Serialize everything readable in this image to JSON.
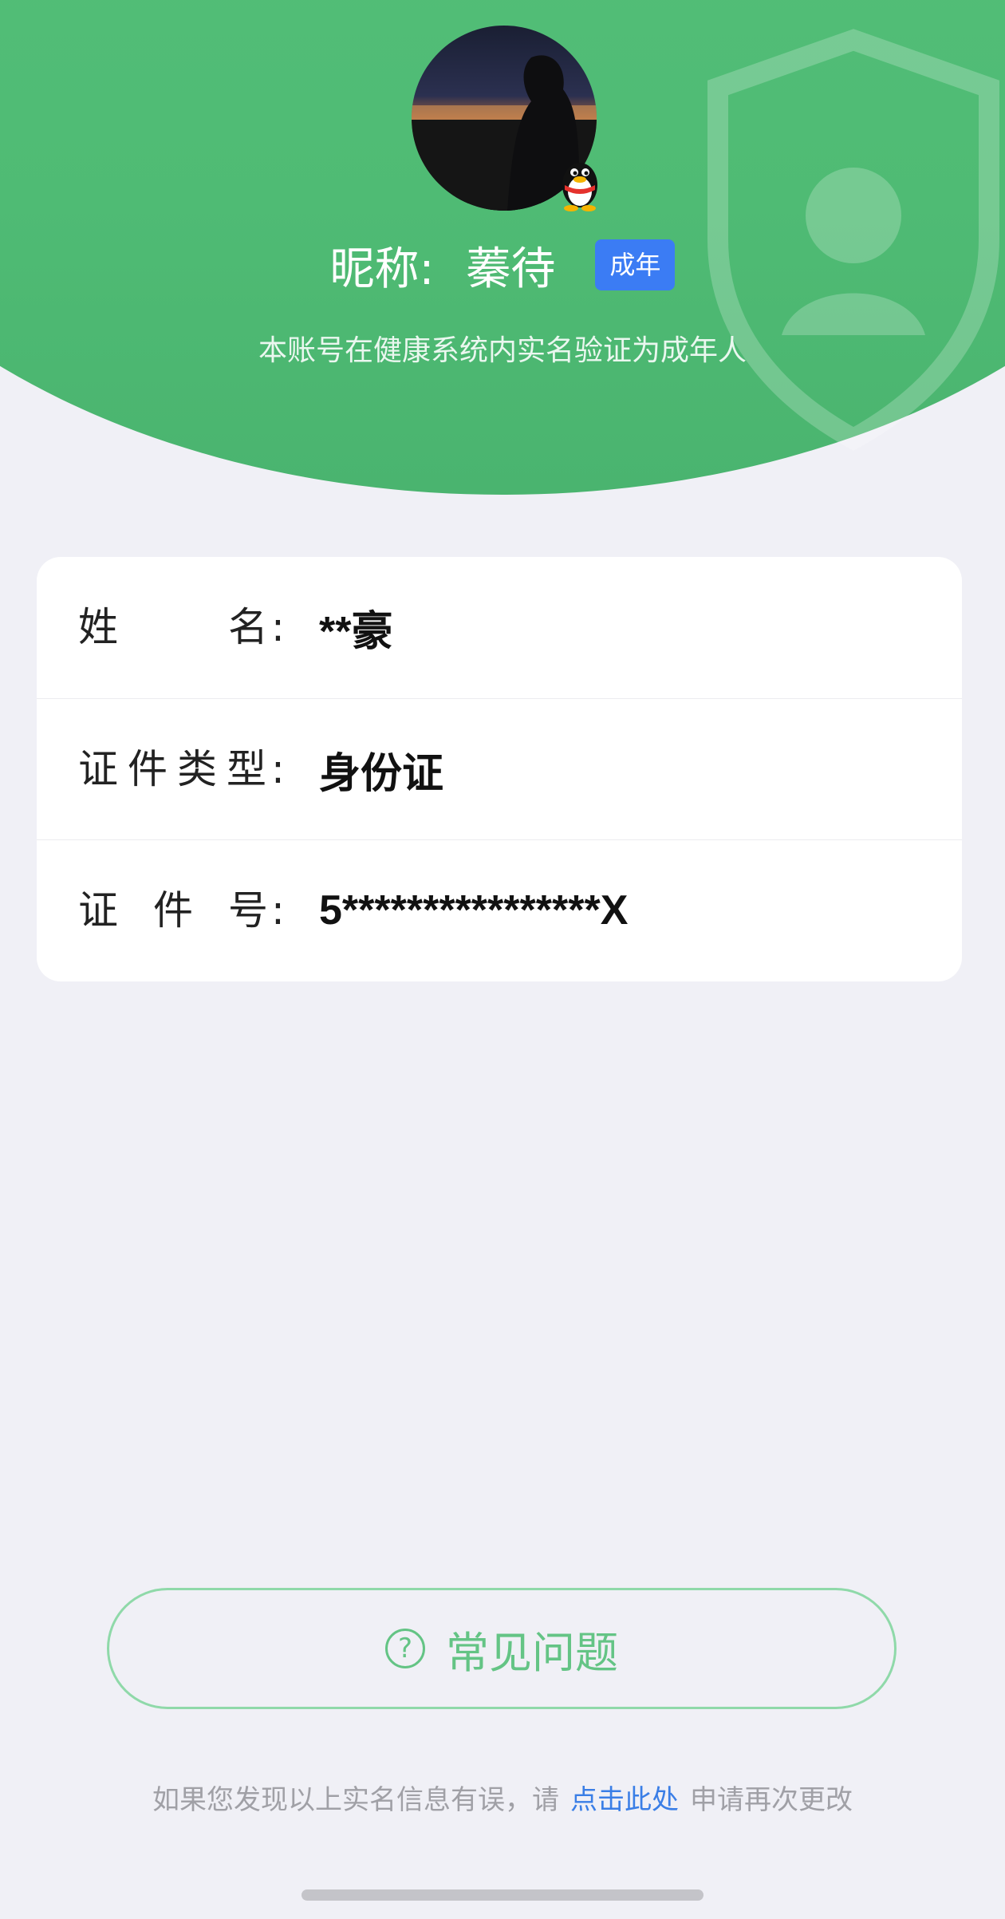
{
  "profile": {
    "nickname_label": "昵称:",
    "nickname": "蓁待",
    "age_badge": "成年",
    "verify_text": "本账号在健康系统内实名验证为成年人"
  },
  "info": {
    "rows": [
      {
        "label_chars": [
          "姓",
          "名",
          ":"
        ],
        "value": "**豪"
      },
      {
        "label_chars": [
          "证",
          "件",
          "类",
          "型",
          ":"
        ],
        "value": "身份证"
      },
      {
        "label_chars": [
          "证",
          "件",
          "号",
          ":"
        ],
        "value": "5****************X"
      }
    ]
  },
  "faq": {
    "label": "常见问题",
    "icon_glyph": "?"
  },
  "footer": {
    "prefix": "如果您发现以上实名信息有误，请",
    "link": "点击此处",
    "suffix": "申请再次更改"
  },
  "colors": {
    "header_green": "#57c27c",
    "badge_blue": "#3b7cf4",
    "link_blue": "#3a7ee6",
    "faq_green": "#64c485",
    "page_bg": "#f0f0f6"
  },
  "icons": {
    "qq_badge": "qq-penguin-icon",
    "faq_icon": "question-circle-icon",
    "watermark": "shield-icon"
  }
}
